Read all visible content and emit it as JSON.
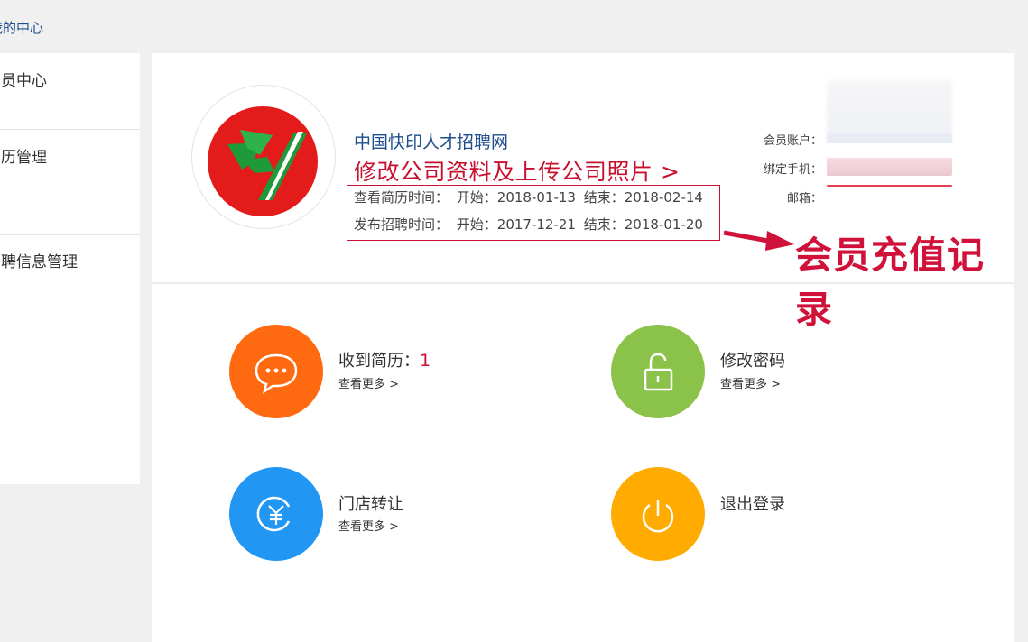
{
  "breadcrumb": "我的中心",
  "sidebar": {
    "items": [
      {
        "label": "会员中心"
      },
      {
        "label": "简历管理"
      },
      {
        "label": "招聘信息管理"
      }
    ]
  },
  "profile": {
    "company_name": "中国快印人才招聘网",
    "edit_link": "修改公司资料及上传公司照片 >",
    "resume_view_label": "查看简历时间：",
    "resume_view_start": "开始：2018-01-13",
    "resume_view_end": "结束：2018-02-14",
    "job_post_label": "发布招聘时间：",
    "job_post_start": "开始：2017-12-21",
    "job_post_end": "结束：2018-01-20"
  },
  "account": {
    "member_account_label": "会员账户：",
    "phone_label": "绑定手机：",
    "email_label": "邮箱："
  },
  "callout": "会员充值记录",
  "tiles": [
    {
      "title": "收到简历：",
      "count": "1",
      "more": "查看更多 >",
      "icon": "chat-bubble-icon",
      "color": "#ff6a10"
    },
    {
      "title": "修改密码",
      "more": "查看更多 >",
      "icon": "unlock-icon",
      "color": "#8bc34a"
    },
    {
      "title": "门店转让",
      "more": "查看更多 >",
      "icon": "yen-coin-icon",
      "color": "#2196f3"
    },
    {
      "title": "退出登录",
      "icon": "power-icon",
      "color": "#ffab00"
    }
  ],
  "colors": {
    "accent_red": "#c8102e",
    "link_blue": "#1f4e8c"
  }
}
